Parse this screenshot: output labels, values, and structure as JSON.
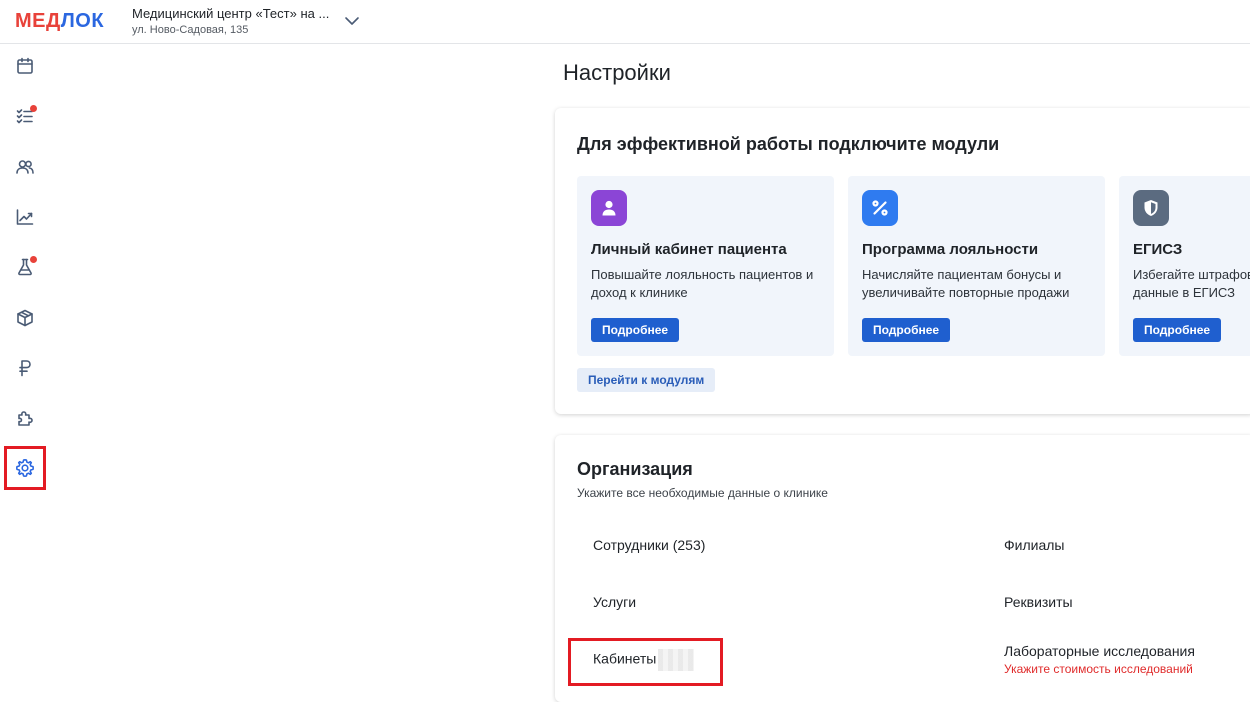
{
  "header": {
    "logo_part1": "МЕД",
    "logo_part2": "ЛОК",
    "clinic_name": "Медицинский центр «Тест» на ...",
    "clinic_address": "ул. Ново-Садовая, 135"
  },
  "sidebar": {
    "items": [
      {
        "name": "calendar",
        "badge": false
      },
      {
        "name": "tasks",
        "badge": true
      },
      {
        "name": "patients",
        "badge": false
      },
      {
        "name": "analytics",
        "badge": false
      },
      {
        "name": "laboratory",
        "badge": true
      },
      {
        "name": "warehouse",
        "badge": false
      },
      {
        "name": "finance",
        "badge": false
      },
      {
        "name": "modules",
        "badge": false
      },
      {
        "name": "settings",
        "badge": false,
        "active": true
      }
    ]
  },
  "page": {
    "title": "Настройки"
  },
  "modules_card": {
    "title": "Для эффективной работы подключите модули",
    "modules": [
      {
        "title": "Личный кабинет пациента",
        "description": "Повышайте лояльность пациентов и доход к клинике",
        "button": "Подробнее",
        "icon": "user-icon",
        "icon_color": "#8b45d6"
      },
      {
        "title": "Программа лояльности",
        "description": "Начисляйте пациентам бонусы и увеличивайте повторные продажи",
        "button": "Подробнее",
        "icon": "percent-icon",
        "icon_color": "#2f7bf0"
      },
      {
        "title": "ЕГИСЗ",
        "description": "Избегайте штрафов — передавайте данные в ЕГИСЗ",
        "button": "Подробнее",
        "icon": "shield-icon",
        "icon_color": "#5b6b80"
      }
    ],
    "link": "Перейти к модулям"
  },
  "org_card": {
    "title": "Организация",
    "subtitle": "Укажите все необходимые данные о клинике",
    "items": {
      "employees": "Сотрудники (253)",
      "branches": "Филиалы",
      "services": "Услуги",
      "requisites": "Реквизиты",
      "rooms": "Кабинеты",
      "lab": "Лабораторные исследования",
      "lab_warning": "Укажите стоимость исследований"
    }
  },
  "colors": {
    "accent": "#1f5fcf",
    "logo_red": "#e8423a",
    "logo_blue": "#2b67e0",
    "warning": "#e02b2b",
    "highlight": "#e31b23"
  }
}
